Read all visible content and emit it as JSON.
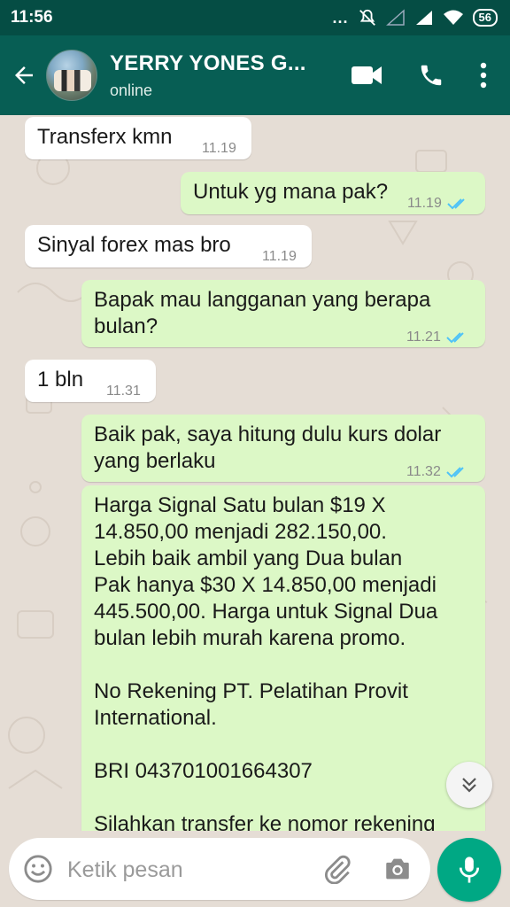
{
  "status_bar": {
    "time": "11:56",
    "dots": "...",
    "battery": "56"
  },
  "header": {
    "contact_name": "YERRY YONES G...",
    "contact_status": "online"
  },
  "messages": [
    {
      "direction": "in",
      "text": "Transferx kmn",
      "time": "11.19"
    },
    {
      "direction": "out",
      "text": "Untuk yg mana pak?",
      "time": "11.19",
      "read": true
    },
    {
      "direction": "in",
      "text": "Sinyal forex mas bro",
      "time": "11.19"
    },
    {
      "direction": "out",
      "text": "Bapak mau langganan yang berapa\nbulan?",
      "time": "11.21",
      "read": true
    },
    {
      "direction": "in",
      "text": "1 bln",
      "time": "11.31"
    },
    {
      "direction": "out",
      "text": "Baik pak, saya hitung dulu kurs dolar\nyang berlaku",
      "time": "11.32",
      "read": true
    },
    {
      "direction": "out",
      "text": "Harga Signal Satu bulan $19 X\n14.850,00 menjadi 282.150,00.\nLebih baik ambil yang Dua bulan\nPak hanya $30 X 14.850,00 menjadi\n445.500,00. Harga untuk Signal Dua\nbulan lebih murah karena promo.\n\nNo Rekening PT. Pelatihan Provit\nInternational.\n\nBRI 043701001664307\n\nSilahkan transfer ke nomor rekening"
    }
  ],
  "composer": {
    "placeholder": "Ketik pesan"
  },
  "colors": {
    "header": "#075e54",
    "status_bar": "#054d44",
    "chat_background": "#e5ddd5",
    "outgoing_bubble": "#dcf8c6",
    "incoming_bubble": "#ffffff",
    "read_ticks": "#4fc3f7",
    "mic_button": "#00a884"
  },
  "icons": {
    "back": "arrow-left-icon",
    "video_call": "video-camera-icon",
    "voice_call": "phone-icon",
    "menu": "more-vertical-icon",
    "emoji": "smiley-icon",
    "attach": "paperclip-icon",
    "camera": "camera-icon",
    "mic": "microphone-icon",
    "scroll": "chevrons-down-icon"
  }
}
